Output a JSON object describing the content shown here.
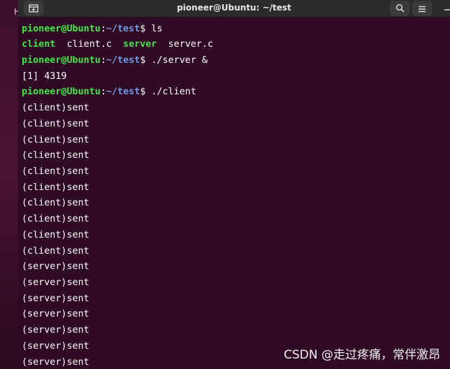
{
  "desktop": {
    "fragment": "H"
  },
  "window": {
    "title": "pioneer@Ubuntu: ~/test",
    "new_tab_icon": "new-tab-icon",
    "search_icon": "search-icon",
    "menu_icon": "hamburger-menu-icon",
    "minimize_icon": "minimize-icon"
  },
  "prompt": {
    "user_host": "pioneer@Ubuntu",
    "sep": ":",
    "path": "~/test",
    "dollar": "$"
  },
  "commands": {
    "ls": "ls",
    "server": "./server &",
    "client": "./client"
  },
  "ls_output": {
    "f1": "client",
    "f2": "client.c",
    "f3": "server",
    "f4": "server.c"
  },
  "job_output": "[1] 4319",
  "output_lines": [
    "(client)sent",
    "(client)sent",
    "(client)sent",
    "(client)sent",
    "(client)sent",
    "(client)sent",
    "(client)sent",
    "(client)sent",
    "(client)sent",
    "(client)sent",
    "(server)sent",
    "(server)sent",
    "(server)sent",
    "(server)sent",
    "(server)sent",
    "(server)sent",
    "(server)sent"
  ],
  "watermark": "CSDN @走过疼痛，常伴激昂",
  "colors": {
    "terminal_bg": "#300a24",
    "prompt_user": "#4ce04c",
    "prompt_path": "#6f9ae6",
    "text": "#ffffff"
  }
}
